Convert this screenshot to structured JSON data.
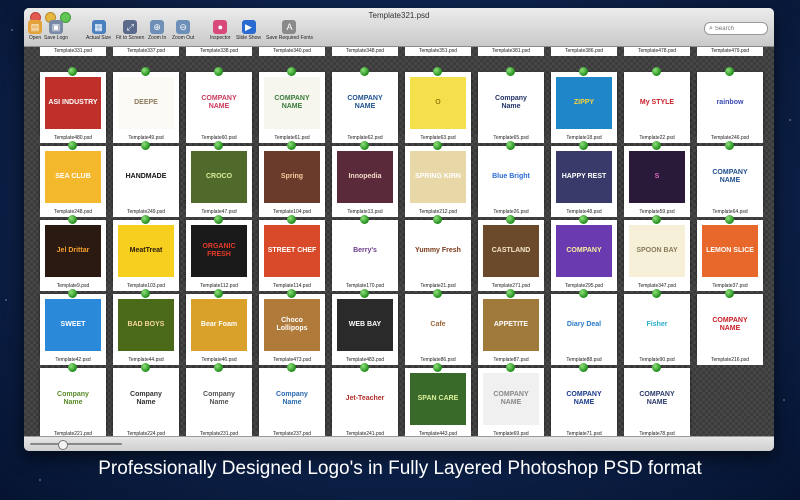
{
  "window": {
    "title": "Template321.psd"
  },
  "toolbar": [
    {
      "label": "Open",
      "icon": "folder-icon",
      "color": "#e3a23a",
      "glyph": "▤"
    },
    {
      "label": "Save Logo",
      "icon": "save-icon",
      "color": "#7a8aa6",
      "glyph": "▣"
    },
    {
      "label": "Actual Size",
      "icon": "actual-size-icon",
      "color": "#4a7fc0",
      "glyph": "▦"
    },
    {
      "label": "Fit to Screen",
      "icon": "fit-screen-icon",
      "color": "#5a6a8a",
      "glyph": "⤢"
    },
    {
      "label": "Zoom In",
      "icon": "zoom-in-icon",
      "color": "#6d8fb8",
      "glyph": "⊕"
    },
    {
      "label": "Zoom Out",
      "icon": "zoom-out-icon",
      "color": "#6d8fb8",
      "glyph": "⊖"
    },
    {
      "label": "Inspector",
      "icon": "inspector-icon",
      "color": "#d9487a",
      "glyph": "●"
    },
    {
      "label": "Slide Show",
      "icon": "slideshow-icon",
      "color": "#2a6bd1",
      "glyph": "▶"
    },
    {
      "label": "Save Required Fonts",
      "icon": "fonts-icon",
      "color": "#8a8a8a",
      "glyph": "A"
    }
  ],
  "search": {
    "placeholder": "Search"
  },
  "top_labels": [
    "Template331.psd",
    "Template337.psd",
    "Template338.psd",
    "Template340.psd",
    "Template348.psd",
    "Template351.psd",
    "Template381.psd",
    "Template386.psd",
    "Template478.psd",
    "Template479.psd"
  ],
  "rows": [
    [
      {
        "file": "Template480.psd",
        "bg": "#c0302a",
        "fg": "#ffffff",
        "text": "ASI INDUSTRY"
      },
      {
        "file": "Template49.psd",
        "bg": "#fbfaf4",
        "fg": "#8b7a60",
        "text": "DEEPE"
      },
      {
        "file": "Template60.psd",
        "bg": "#ffffff",
        "fg": "#c83a5a",
        "text": "COMPANY NAME"
      },
      {
        "file": "Template61.psd",
        "bg": "#f6f6ee",
        "fg": "#3a7a3a",
        "text": "COMPANY NAME"
      },
      {
        "file": "Template62.psd",
        "bg": "#ffffff",
        "fg": "#1f4f8f",
        "text": "COMPANY NAME"
      },
      {
        "file": "Template63.psd",
        "bg": "#f4e04a",
        "fg": "#9a7a10",
        "text": "O"
      },
      {
        "file": "Template65.psd",
        "bg": "#ffffff",
        "fg": "#223366",
        "text": "Company Name"
      },
      {
        "file": "Template18.psd",
        "bg": "#1f86c9",
        "fg": "#f6d23a",
        "text": "ZIPPY"
      },
      {
        "file": "Template22.psd",
        "bg": "#ffffff",
        "fg": "#c8202a",
        "text": "My STYLE"
      },
      {
        "file": "Template246.psd",
        "bg": "#ffffff",
        "fg": "#3a4ab0",
        "text": "rainbow"
      }
    ],
    [
      {
        "file": "Template248.psd",
        "bg": "#f4b82c",
        "fg": "#ffffff",
        "text": "SEA CLUB"
      },
      {
        "file": "Template249.psd",
        "bg": "#ffffff",
        "fg": "#111111",
        "text": "HANDMADE"
      },
      {
        "file": "Template47.psd",
        "bg": "#4f6a2a",
        "fg": "#d9ec9a",
        "text": "CROCO"
      },
      {
        "file": "Template104.psd",
        "bg": "#6a3b2a",
        "fg": "#f6c9a0",
        "text": "Spring"
      },
      {
        "file": "Template13.psd",
        "bg": "#5a2a3a",
        "fg": "#f2d8c8",
        "text": "Innopedia"
      },
      {
        "file": "Template212.psd",
        "bg": "#e8d8a8",
        "fg": "#ffffff",
        "text": "SPRING KIRN"
      },
      {
        "file": "Template26.psd",
        "bg": "#ffffff",
        "fg": "#2a6ad1",
        "text": "Blue Bright"
      },
      {
        "file": "Template48.psd",
        "bg": "#3a3a6a",
        "fg": "#ffffff",
        "text": "HAPPY REST"
      },
      {
        "file": "Template59.psd",
        "bg": "#2a1a3a",
        "fg": "#e06ac0",
        "text": "S"
      },
      {
        "file": "Template64.psd",
        "bg": "#ffffff",
        "fg": "#1f4f8f",
        "text": "COMPANY NAME"
      }
    ],
    [
      {
        "file": "Template9.psd",
        "bg": "#2a1a12",
        "fg": "#f6a030",
        "text": "Jel Drittar"
      },
      {
        "file": "Template103.psd",
        "bg": "#f6cf1f",
        "fg": "#2a1a0a",
        "text": "MeatTreat"
      },
      {
        "file": "Template112.psd",
        "bg": "#1a1a1a",
        "fg": "#e63a2a",
        "text": "ORGANIC FRESH"
      },
      {
        "file": "Template114.psd",
        "bg": "#d94a2a",
        "fg": "#ffffff",
        "text": "STREET CHEF"
      },
      {
        "file": "Template170.psd",
        "bg": "#ffffff",
        "fg": "#6a3a8a",
        "text": "Berry's"
      },
      {
        "file": "Template21.psd",
        "bg": "#ffffff",
        "fg": "#7a3a1a",
        "text": "Yummy Fresh"
      },
      {
        "file": "Template271.psd",
        "bg": "#6a4a2a",
        "fg": "#f6e6c8",
        "text": "CASTLAND"
      },
      {
        "file": "Template295.psd",
        "bg": "#6a3ab0",
        "fg": "#f6f0a0",
        "text": "COMPANY"
      },
      {
        "file": "Template347.psd",
        "bg": "#f6f0d8",
        "fg": "#8a7a5a",
        "text": "SPOON BAY"
      },
      {
        "file": "Template37.psd",
        "bg": "#e8672a",
        "fg": "#ffffff",
        "text": "LEMON SLICE"
      }
    ],
    [
      {
        "file": "Template42.psd",
        "bg": "#2a8ad9",
        "fg": "#ffffff",
        "text": "SWEET"
      },
      {
        "file": "Template44.psd",
        "bg": "#4a6a1a",
        "fg": "#f6d89a",
        "text": "BAD BOYS"
      },
      {
        "file": "Template46.psd",
        "bg": "#d9a02a",
        "fg": "#ffffff",
        "text": "Bear Foam"
      },
      {
        "file": "Template473.psd",
        "bg": "#b07a3a",
        "fg": "#ffffff",
        "text": "Choco Lollipops"
      },
      {
        "file": "Template483.psd",
        "bg": "#2a2a2a",
        "fg": "#ffffff",
        "text": "WEB BAY"
      },
      {
        "file": "Template86.psd",
        "bg": "#ffffff",
        "fg": "#a0683a",
        "text": "Cafe"
      },
      {
        "file": "Template87.psd",
        "bg": "#a07a3a",
        "fg": "#ffffff",
        "text": "APPETITE"
      },
      {
        "file": "Template88.psd",
        "bg": "#ffffff",
        "fg": "#2a7ac9",
        "text": "Diary Deal"
      },
      {
        "file": "Template90.psd",
        "bg": "#ffffff",
        "fg": "#2ab0c9",
        "text": "Fisher"
      },
      {
        "file": "Template216.psd",
        "bg": "#ffffff",
        "fg": "#c8202a",
        "text": "COMPANY NAME"
      }
    ],
    [
      {
        "file": "Template221.psd",
        "bg": "#ffffff",
        "fg": "#5a8a2a",
        "text": "Company Name"
      },
      {
        "file": "Template224.psd",
        "bg": "#ffffff",
        "fg": "#333333",
        "text": "Company Name"
      },
      {
        "file": "Template231.psd",
        "bg": "#ffffff",
        "fg": "#555555",
        "text": "Company Name"
      },
      {
        "file": "Template237.psd",
        "bg": "#ffffff",
        "fg": "#2a6ab0",
        "text": "Company Name"
      },
      {
        "file": "Template241.psd",
        "bg": "#ffffff",
        "fg": "#b0302a",
        "text": "Jet-Teacher"
      },
      {
        "file": "Template443.psd",
        "bg": "#3a6a2a",
        "fg": "#d9f09a",
        "text": "SPAN CARE"
      },
      {
        "file": "Template69.psd",
        "bg": "#f0f0f0",
        "fg": "#888888",
        "text": "COMPANY NAME"
      },
      {
        "file": "Template71.psd",
        "bg": "#ffffff",
        "fg": "#1a3a8a",
        "text": "COMPANY NAME"
      },
      {
        "file": "Template78.psd",
        "bg": "#ffffff",
        "fg": "#2a3a6a",
        "text": "COMPANY NAME"
      }
    ]
  ],
  "zoom": {
    "level": 0.35
  },
  "caption": "Professionally Designed Logo's in Fully Layered Photoshop PSD format"
}
